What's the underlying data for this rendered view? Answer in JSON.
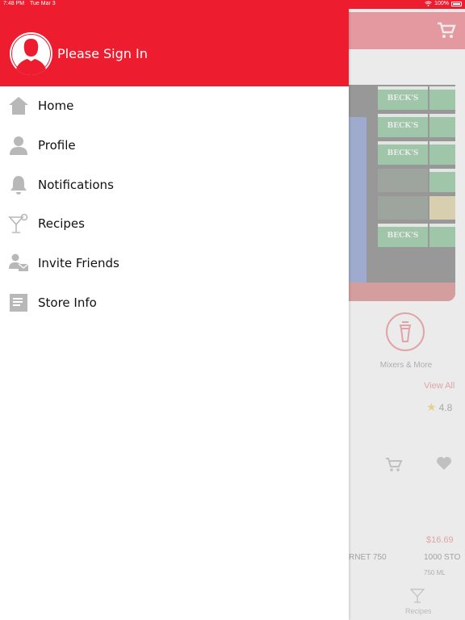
{
  "status_bar": {
    "time": "7:48 PM",
    "date": "Tue Mar 3",
    "battery": "100%"
  },
  "drawer": {
    "header_text": "Please Sign In",
    "items": [
      {
        "label": "Home",
        "icon": "home-icon"
      },
      {
        "label": "Profile",
        "icon": "person-icon"
      },
      {
        "label": "Notifications",
        "icon": "bell-icon"
      },
      {
        "label": "Recipes",
        "icon": "cocktail-icon"
      },
      {
        "label": "Invite Friends",
        "icon": "invite-icon"
      },
      {
        "label": "Store Info",
        "icon": "document-icon"
      }
    ]
  },
  "background": {
    "banner_brand": "BECK'S",
    "category_label": "Mixers & More",
    "view_all": "View All",
    "rating": "4.8",
    "price": "$16.69",
    "product_1": "RNET 750",
    "product_2": "1000 STO",
    "product_size": "750 ML",
    "tab_recipes": "Recipes"
  },
  "colors": {
    "brand_red": "#ed1c2e",
    "icon_gray": "#b8b8b8"
  }
}
